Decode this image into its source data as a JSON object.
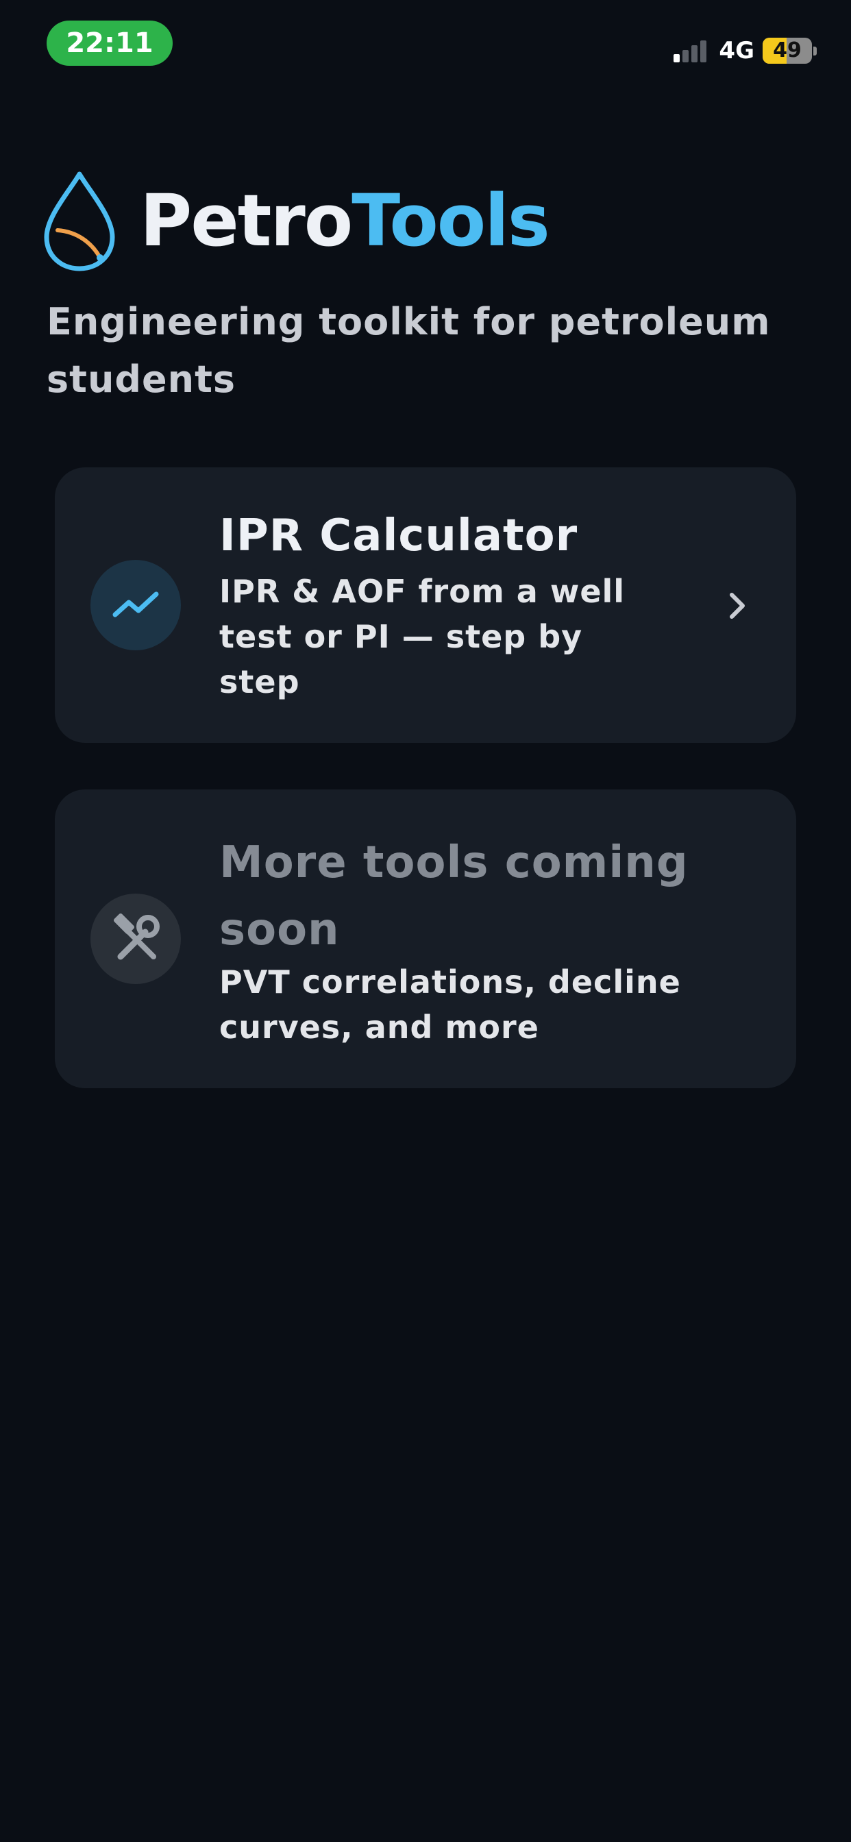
{
  "status_bar": {
    "time": "22:11",
    "network": "4G",
    "battery_level": "49",
    "battery_fraction": 0.49,
    "signal_bars_active": 1,
    "signal_bars_total": 4
  },
  "header": {
    "title_part1": "Petro",
    "title_part2": "Tools",
    "tagline": "Engineering toolkit for petroleum students",
    "logo_icon": "oil-drop-gauge-icon"
  },
  "tools": [
    {
      "title": "IPR Calculator",
      "description": "IPR & AOF from a well test or PI — step by step",
      "icon": "trend-line-icon",
      "enabled": true
    },
    {
      "title": "More tools coming soon",
      "description": "PVT correlations, decline curves, and more",
      "icon": "hammer-wrench-icon",
      "enabled": false
    }
  ],
  "colors": {
    "background": "#0a0e15",
    "card": "#171d26",
    "accent": "#4cbcf2",
    "time_pill": "#2db34a",
    "battery": "#f5c91c",
    "gauge_orange": "#f0a04b"
  }
}
